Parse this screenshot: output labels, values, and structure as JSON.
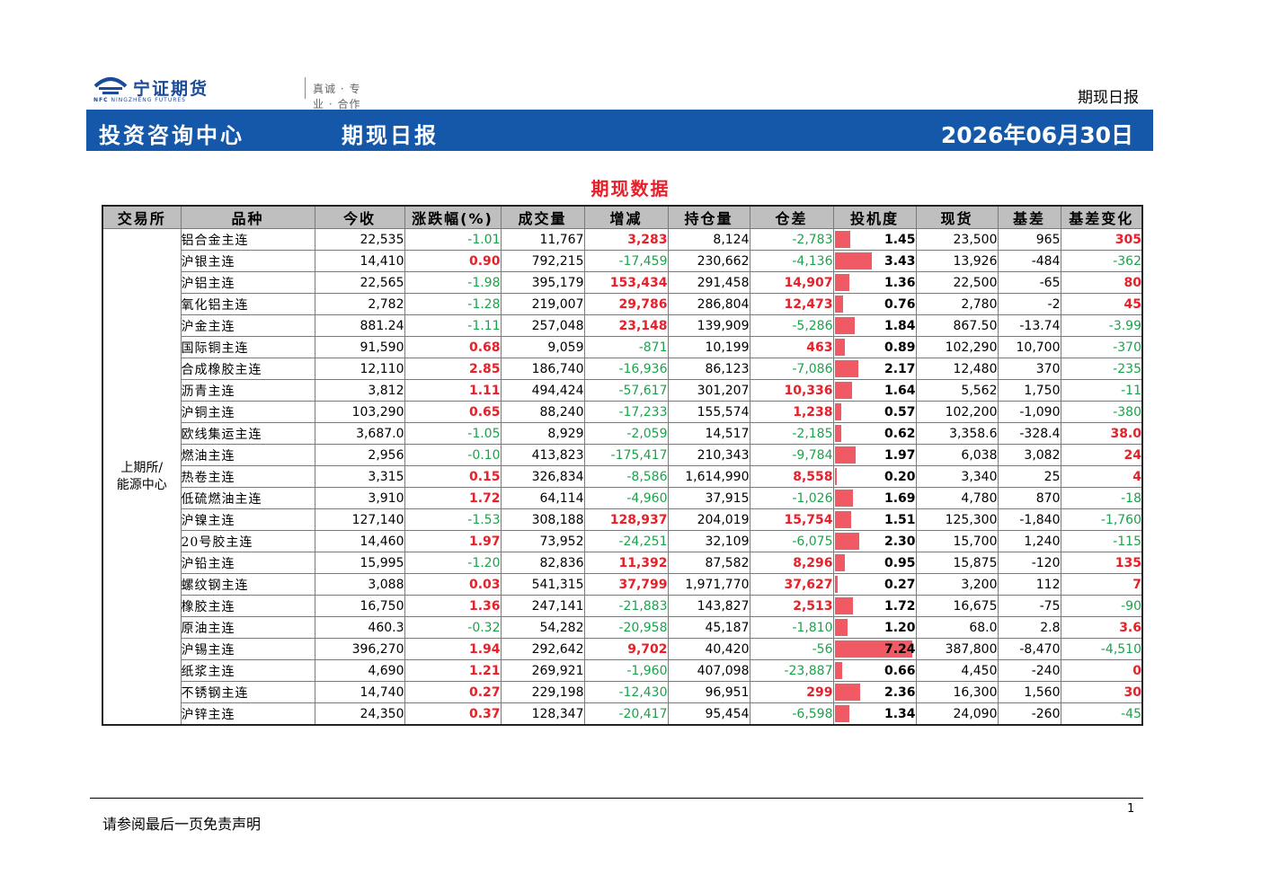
{
  "header": {
    "logo_text": "宁证期货",
    "logo_en": "NINGZHENG FUTURES",
    "logo_mark": "NFC",
    "slogan": "真诚 · 专业 · 合作 · 共赢",
    "report_type": "期现日报"
  },
  "banner": {
    "department": "投资咨询中心",
    "title": "期现日报",
    "date": "2026年06月30日"
  },
  "section_title": "期现数据",
  "colors": {
    "banner": "#1558a9",
    "up": "#e8202a",
    "down": "#1aa34a",
    "bar": "#f05a64"
  },
  "table": {
    "headers": [
      "交易所",
      "品种",
      "今收",
      "涨跌幅(%)",
      "成交量",
      "增减",
      "持仓量",
      "仓差",
      "投机度",
      "现货",
      "基差",
      "基差变化"
    ],
    "exchange": "上期所/\n能源中心",
    "speculation_max": 7.24,
    "rows": [
      {
        "name": "铝合金主连",
        "close": "22,535",
        "chg": "-1.01",
        "vol": "11,767",
        "vol_chg": "3,283",
        "oi": "8,124",
        "oi_chg": "-2,783",
        "spec": 1.45,
        "spec_text": "1.45",
        "spot": "23,500",
        "basis": "965",
        "basis_chg": "305"
      },
      {
        "name": "沪银主连",
        "close": "14,410",
        "chg": "0.90",
        "vol": "792,215",
        "vol_chg": "-17,459",
        "oi": "230,662",
        "oi_chg": "-4,136",
        "spec": 3.43,
        "spec_text": "3.43",
        "spot": "13,926",
        "basis": "-484",
        "basis_chg": "-362"
      },
      {
        "name": "沪铝主连",
        "close": "22,565",
        "chg": "-1.98",
        "vol": "395,179",
        "vol_chg": "153,434",
        "oi": "291,458",
        "oi_chg": "14,907",
        "spec": 1.36,
        "spec_text": "1.36",
        "spot": "22,500",
        "basis": "-65",
        "basis_chg": "80"
      },
      {
        "name": "氧化铝主连",
        "close": "2,782",
        "chg": "-1.28",
        "vol": "219,007",
        "vol_chg": "29,786",
        "oi": "286,804",
        "oi_chg": "12,473",
        "spec": 0.76,
        "spec_text": "0.76",
        "spot": "2,780",
        "basis": "-2",
        "basis_chg": "45"
      },
      {
        "name": "沪金主连",
        "close": "881.24",
        "chg": "-1.11",
        "vol": "257,048",
        "vol_chg": "23,148",
        "oi": "139,909",
        "oi_chg": "-5,286",
        "spec": 1.84,
        "spec_text": "1.84",
        "spot": "867.50",
        "basis": "-13.74",
        "basis_chg": "-3.99"
      },
      {
        "name": "国际铜主连",
        "close": "91,590",
        "chg": "0.68",
        "vol": "9,059",
        "vol_chg": "-871",
        "oi": "10,199",
        "oi_chg": "463",
        "spec": 0.89,
        "spec_text": "0.89",
        "spot": "102,290",
        "basis": "10,700",
        "basis_chg": "-370"
      },
      {
        "name": "合成橡胶主连",
        "close": "12,110",
        "chg": "2.85",
        "vol": "186,740",
        "vol_chg": "-16,936",
        "oi": "86,123",
        "oi_chg": "-7,086",
        "spec": 2.17,
        "spec_text": "2.17",
        "spot": "12,480",
        "basis": "370",
        "basis_chg": "-235"
      },
      {
        "name": "沥青主连",
        "close": "3,812",
        "chg": "1.11",
        "vol": "494,424",
        "vol_chg": "-57,617",
        "oi": "301,207",
        "oi_chg": "10,336",
        "spec": 1.64,
        "spec_text": "1.64",
        "spot": "5,562",
        "basis": "1,750",
        "basis_chg": "-11"
      },
      {
        "name": "沪铜主连",
        "close": "103,290",
        "chg": "0.65",
        "vol": "88,240",
        "vol_chg": "-17,233",
        "oi": "155,574",
        "oi_chg": "1,238",
        "spec": 0.57,
        "spec_text": "0.57",
        "spot": "102,200",
        "basis": "-1,090",
        "basis_chg": "-380"
      },
      {
        "name": "欧线集运主连",
        "close": "3,687.0",
        "chg": "-1.05",
        "vol": "8,929",
        "vol_chg": "-2,059",
        "oi": "14,517",
        "oi_chg": "-2,185",
        "spec": 0.62,
        "spec_text": "0.62",
        "spot": "3,358.6",
        "basis": "-328.4",
        "basis_chg": "38.0"
      },
      {
        "name": "燃油主连",
        "close": "2,956",
        "chg": "-0.10",
        "vol": "413,823",
        "vol_chg": "-175,417",
        "oi": "210,343",
        "oi_chg": "-9,784",
        "spec": 1.97,
        "spec_text": "1.97",
        "spot": "6,038",
        "basis": "3,082",
        "basis_chg": "24"
      },
      {
        "name": "热卷主连",
        "close": "3,315",
        "chg": "0.15",
        "vol": "326,834",
        "vol_chg": "-8,586",
        "oi": "1,614,990",
        "oi_chg": "8,558",
        "spec": 0.2,
        "spec_text": "0.20",
        "spot": "3,340",
        "basis": "25",
        "basis_chg": "4"
      },
      {
        "name": "低硫燃油主连",
        "close": "3,910",
        "chg": "1.72",
        "vol": "64,114",
        "vol_chg": "-4,960",
        "oi": "37,915",
        "oi_chg": "-1,026",
        "spec": 1.69,
        "spec_text": "1.69",
        "spot": "4,780",
        "basis": "870",
        "basis_chg": "-18"
      },
      {
        "name": "沪镍主连",
        "close": "127,140",
        "chg": "-1.53",
        "vol": "308,188",
        "vol_chg": "128,937",
        "oi": "204,019",
        "oi_chg": "15,754",
        "spec": 1.51,
        "spec_text": "1.51",
        "spot": "125,300",
        "basis": "-1,840",
        "basis_chg": "-1,760"
      },
      {
        "name": "20号胶主连",
        "close": "14,460",
        "chg": "1.97",
        "vol": "73,952",
        "vol_chg": "-24,251",
        "oi": "32,109",
        "oi_chg": "-6,075",
        "spec": 2.3,
        "spec_text": "2.30",
        "spot": "15,700",
        "basis": "1,240",
        "basis_chg": "-115"
      },
      {
        "name": "沪铅主连",
        "close": "15,995",
        "chg": "-1.20",
        "vol": "82,836",
        "vol_chg": "11,392",
        "oi": "87,582",
        "oi_chg": "8,296",
        "spec": 0.95,
        "spec_text": "0.95",
        "spot": "15,875",
        "basis": "-120",
        "basis_chg": "135"
      },
      {
        "name": "螺纹钢主连",
        "close": "3,088",
        "chg": "0.03",
        "vol": "541,315",
        "vol_chg": "37,799",
        "oi": "1,971,770",
        "oi_chg": "37,627",
        "spec": 0.27,
        "spec_text": "0.27",
        "spot": "3,200",
        "basis": "112",
        "basis_chg": "7"
      },
      {
        "name": "橡胶主连",
        "close": "16,750",
        "chg": "1.36",
        "vol": "247,141",
        "vol_chg": "-21,883",
        "oi": "143,827",
        "oi_chg": "2,513",
        "spec": 1.72,
        "spec_text": "1.72",
        "spot": "16,675",
        "basis": "-75",
        "basis_chg": "-90"
      },
      {
        "name": "原油主连",
        "close": "460.3",
        "chg": "-0.32",
        "vol": "54,282",
        "vol_chg": "-20,958",
        "oi": "45,187",
        "oi_chg": "-1,810",
        "spec": 1.2,
        "spec_text": "1.20",
        "spot": "68.0",
        "basis": "2.8",
        "basis_chg": "3.6"
      },
      {
        "name": "沪锡主连",
        "close": "396,270",
        "chg": "1.94",
        "vol": "292,642",
        "vol_chg": "9,702",
        "oi": "40,420",
        "oi_chg": "-56",
        "spec": 7.24,
        "spec_text": "7.24",
        "spot": "387,800",
        "basis": "-8,470",
        "basis_chg": "-4,510"
      },
      {
        "name": "纸浆主连",
        "close": "4,690",
        "chg": "1.21",
        "vol": "269,921",
        "vol_chg": "-1,960",
        "oi": "407,098",
        "oi_chg": "-23,887",
        "spec": 0.66,
        "spec_text": "0.66",
        "spot": "4,450",
        "basis": "-240",
        "basis_chg": "0"
      },
      {
        "name": "不锈钢主连",
        "close": "14,740",
        "chg": "0.27",
        "vol": "229,198",
        "vol_chg": "-12,430",
        "oi": "96,951",
        "oi_chg": "299",
        "spec": 2.36,
        "spec_text": "2.36",
        "spot": "16,300",
        "basis": "1,560",
        "basis_chg": "30"
      },
      {
        "name": "沪锌主连",
        "close": "24,350",
        "chg": "0.37",
        "vol": "128,347",
        "vol_chg": "-20,417",
        "oi": "95,454",
        "oi_chg": "-6,598",
        "spec": 1.34,
        "spec_text": "1.34",
        "spot": "24,090",
        "basis": "-260",
        "basis_chg": "-45"
      }
    ]
  },
  "footer": {
    "disclaimer": "请参阅最后一页免责声明",
    "page": "1"
  }
}
